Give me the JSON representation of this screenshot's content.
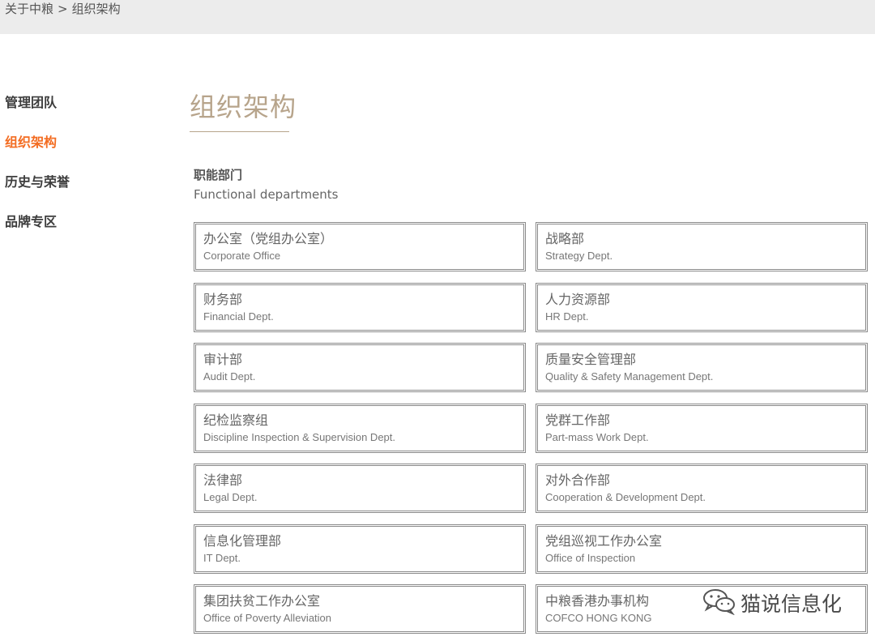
{
  "breadcrumb": {
    "parent": "关于中粮",
    "separator": ">",
    "current": "组织架构"
  },
  "sidebar": {
    "items": [
      {
        "label": "管理团队",
        "active": false
      },
      {
        "label": "组织架构",
        "active": true
      },
      {
        "label": "历史与荣誉",
        "active": false
      },
      {
        "label": "品牌专区",
        "active": false
      }
    ]
  },
  "main": {
    "title": "组织架构",
    "section_zh": "职能部门",
    "section_en": "Functional departments",
    "departments": [
      {
        "zh": "办公室（党组办公室）",
        "en": "Corporate Office"
      },
      {
        "zh": "战略部",
        "en": "Strategy Dept."
      },
      {
        "zh": "财务部",
        "en": "Financial Dept."
      },
      {
        "zh": "人力资源部",
        "en": "HR Dept."
      },
      {
        "zh": "审计部",
        "en": "Audit Dept."
      },
      {
        "zh": "质量安全管理部",
        "en": "Quality & Safety Management Dept."
      },
      {
        "zh": "纪检监察组",
        "en": "Discipline Inspection & Supervision Dept."
      },
      {
        "zh": "党群工作部",
        "en": "Part-mass Work Dept."
      },
      {
        "zh": "法律部",
        "en": "Legal Dept."
      },
      {
        "zh": "对外合作部",
        "en": "Cooperation & Development Dept."
      },
      {
        "zh": "信息化管理部",
        "en": "IT Dept."
      },
      {
        "zh": "党组巡视工作办公室",
        "en": "Office of Inspection"
      },
      {
        "zh": "集团扶贫工作办公室",
        "en": "Office of Poverty Alleviation"
      },
      {
        "zh": "中粮香港办事机构",
        "en": "COFCO HONG KONG"
      }
    ]
  },
  "watermark": {
    "text": "猫说信息化",
    "icon": "wechat-icon"
  },
  "colors": {
    "accent": "#f36c21",
    "title": "#b7a48b",
    "topbar": "#ececec"
  }
}
